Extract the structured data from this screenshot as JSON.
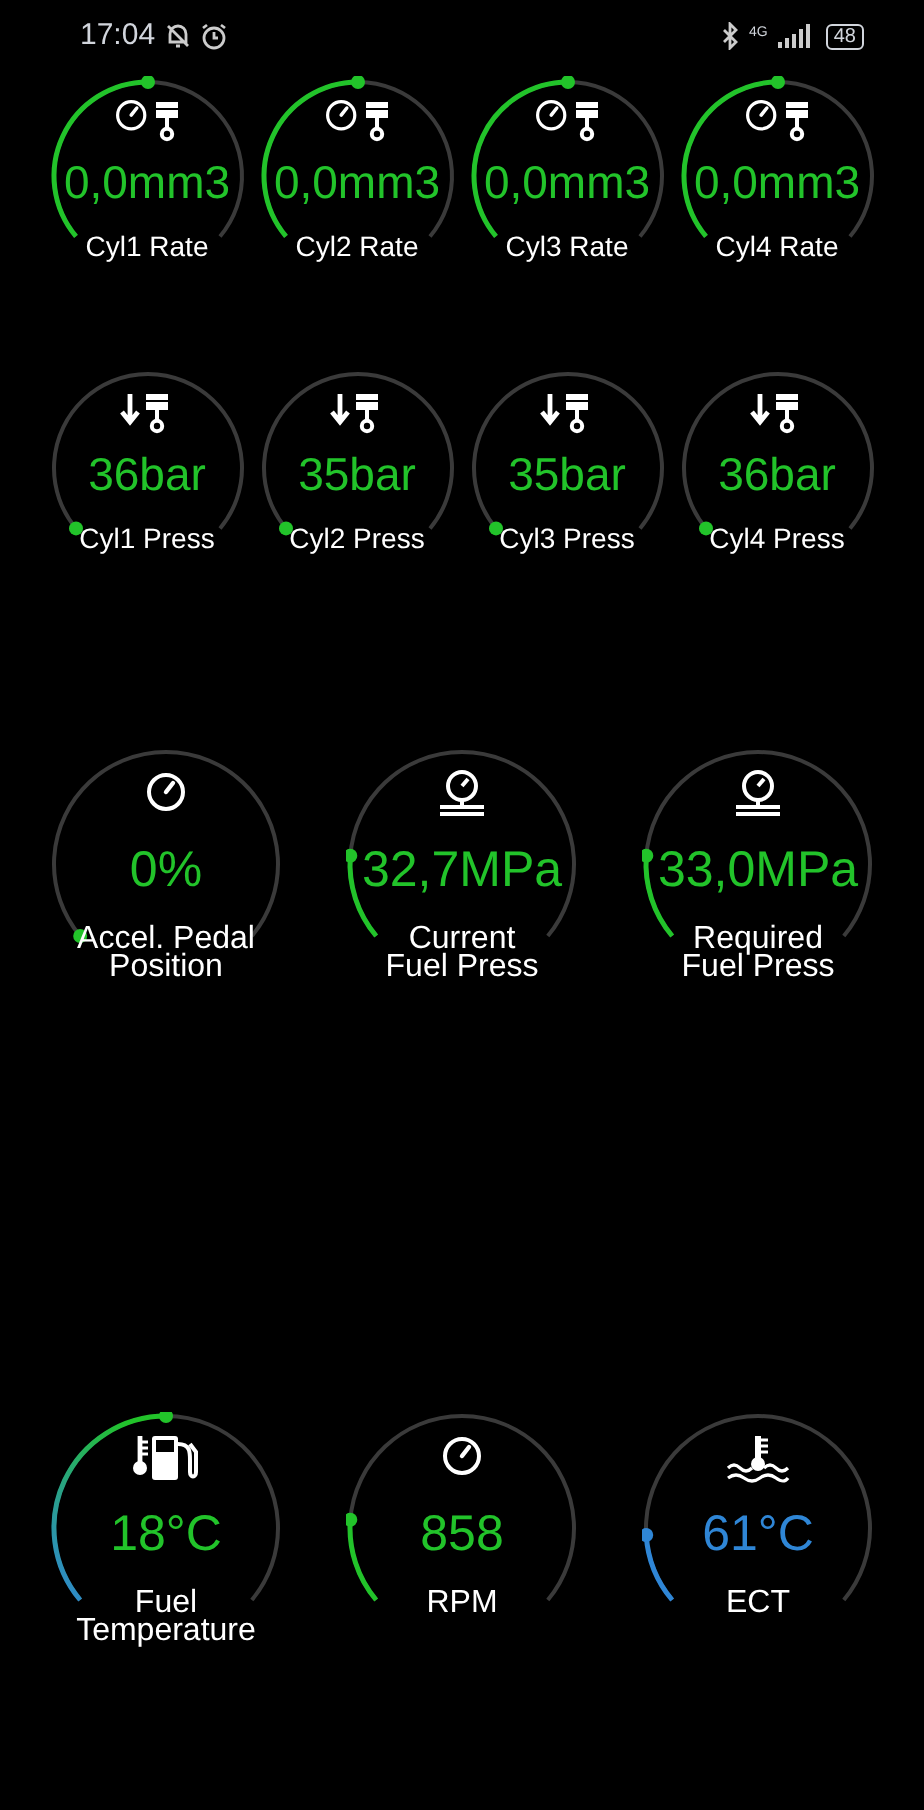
{
  "status_bar": {
    "time": "17:04",
    "network": "4G",
    "battery": "48"
  },
  "rows": [
    {
      "gauges": [
        {
          "kind": "injection_rate",
          "value": "0,0mm3",
          "label": "Cyl1 Rate",
          "color": "#22c32a"
        },
        {
          "kind": "injection_rate",
          "value": "0,0mm3",
          "label": "Cyl2 Rate",
          "color": "#22c32a"
        },
        {
          "kind": "injection_rate",
          "value": "0,0mm3",
          "label": "Cyl3 Rate",
          "color": "#22c32a"
        },
        {
          "kind": "injection_rate",
          "value": "0,0mm3",
          "label": "Cyl4 Rate",
          "color": "#22c32a"
        }
      ]
    },
    {
      "gauges": [
        {
          "kind": "cylinder_pressure",
          "value": "36bar",
          "label": "Cyl1 Press",
          "color": "#22c32a"
        },
        {
          "kind": "cylinder_pressure",
          "value": "35bar",
          "label": "Cyl2 Press",
          "color": "#22c32a"
        },
        {
          "kind": "cylinder_pressure",
          "value": "35bar",
          "label": "Cyl3 Press",
          "color": "#22c32a"
        },
        {
          "kind": "cylinder_pressure",
          "value": "36bar",
          "label": "Cyl4 Press",
          "color": "#22c32a"
        }
      ]
    },
    {
      "gauges": [
        {
          "kind": "pedal",
          "value": "0%",
          "label": "Accel. Pedal\nPosition",
          "color": "#22c32a"
        },
        {
          "kind": "rail_pressure",
          "value": "32,7MPa",
          "label": "Current\nFuel Press",
          "color": "#22c32a"
        },
        {
          "kind": "rail_pressure",
          "value": "33,0MPa",
          "label": "Required\nFuel Press",
          "color": "#22c32a"
        }
      ]
    },
    {
      "gauges": [
        {
          "kind": "fuel_temperature",
          "value": "18°C",
          "label": "Fuel\nTemperature",
          "color": "#22c32a"
        },
        {
          "kind": "rpm",
          "value": "858",
          "label": "RPM",
          "color": "#22c32a"
        },
        {
          "kind": "coolant_temperature",
          "value": "61°C",
          "label": "ECT",
          "color": "#2f86d6"
        }
      ]
    }
  ]
}
